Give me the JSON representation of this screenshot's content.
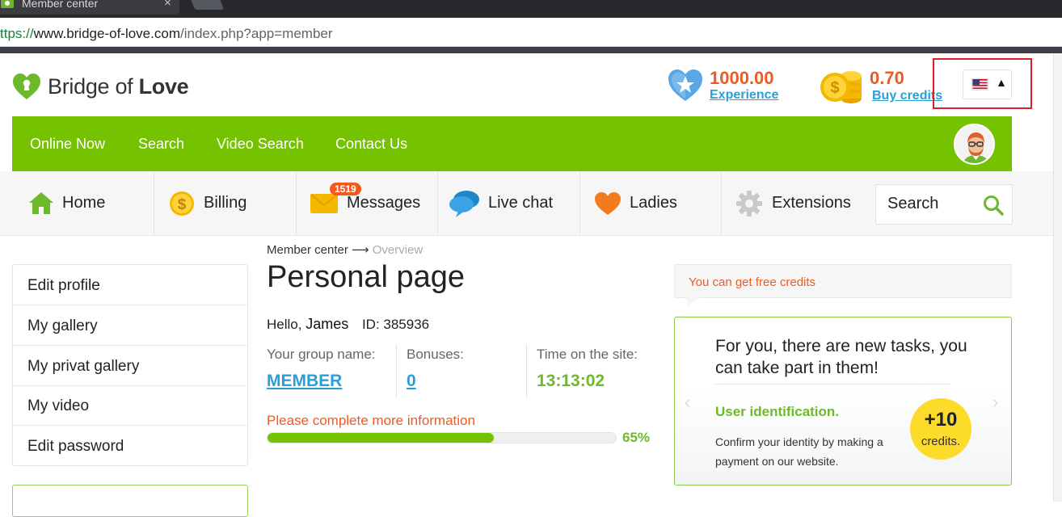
{
  "browser": {
    "tab_title": "Member center",
    "tab_close": "×",
    "url_scheme": "ttps://",
    "url_host": "www.bridge-of-love.com",
    "url_path": "/index.php?app=member"
  },
  "header": {
    "logo_text_light": "Bridge of ",
    "logo_text_bold": "Love",
    "experience_value": "1000.00",
    "experience_label": "Experience",
    "credits_value": "0.70",
    "credits_label": "Buy credits",
    "language_caret": "▲"
  },
  "green_nav": [
    {
      "label": "Online Now"
    },
    {
      "label": "Search"
    },
    {
      "label": "Video Search"
    },
    {
      "label": "Contact Us"
    }
  ],
  "sub_nav": {
    "items": [
      {
        "label": "Home",
        "icon": "home-icon"
      },
      {
        "label": "Billing",
        "icon": "dollar-coin-icon"
      },
      {
        "label": "Messages",
        "icon": "envelope-icon"
      },
      {
        "label": "Live chat",
        "icon": "chat-bubbles-icon"
      },
      {
        "label": "Ladies",
        "icon": "heart-icon"
      },
      {
        "label": "Extensions",
        "icon": "gear-icon"
      }
    ],
    "messages_badge": "1519",
    "search_placeholder": "Search"
  },
  "sidebar": {
    "items": [
      {
        "label": "Edit profile"
      },
      {
        "label": "My gallery"
      },
      {
        "label": "My privat gallery"
      },
      {
        "label": "My video"
      },
      {
        "label": "Edit password"
      }
    ]
  },
  "main": {
    "breadcrumb_root": "Member center",
    "breadcrumb_arrow": "⟶",
    "breadcrumb_current": "Overview",
    "title": "Personal page",
    "hello_prefix": "Hello, ",
    "user_name": "James",
    "user_id": "ID: 385936",
    "group_label": "Your group name:",
    "group_value": "MEMBER",
    "bonuses_label": "Bonuses:",
    "bonuses_value": "0",
    "time_label": "Time on the site:",
    "time_value": "13:13:02",
    "complete_text": "Please complete more information",
    "progress_percent": 65,
    "progress_label": "65%"
  },
  "right_panel": {
    "free_credits_note": "You can get free credits",
    "task_title": "For you, there are new tasks, you can take part in them!",
    "task_name": "User identification.",
    "task_desc": "Confirm your identity by making a payment on our website.",
    "bonus_amount": "+10",
    "bonus_unit": "credits.",
    "arrow_left": "‹",
    "arrow_right": "›"
  },
  "colors": {
    "brand_green": "#75c200",
    "accent_orange": "#ee5a24",
    "link_blue": "#2a9fd6",
    "badge_yellow": "#fddb2b"
  }
}
